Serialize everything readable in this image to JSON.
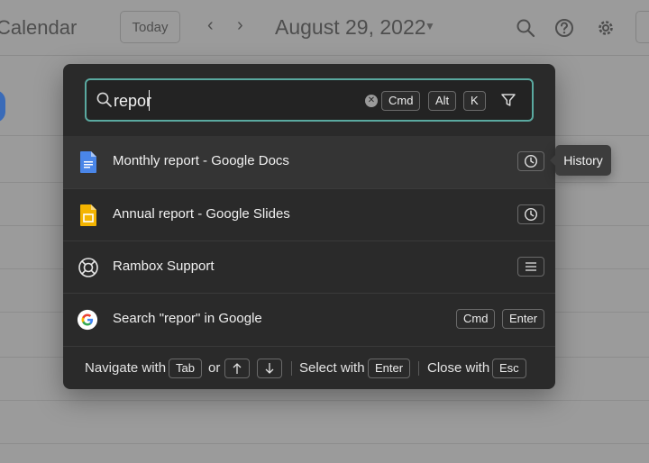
{
  "calendar": {
    "brand": "Calendar",
    "today_label": "Today",
    "prev_glyph": "‹",
    "next_glyph": "›",
    "date_label": "August 29, 2022",
    "icons": [
      "search-icon",
      "help-icon",
      "gear-icon"
    ]
  },
  "palette": {
    "search": {
      "value": "repor",
      "shortcut_keys": [
        "Cmd",
        "Alt",
        "K"
      ],
      "accent": "#5aa9a0"
    },
    "results": [
      {
        "label": "Monthly report - Google Docs",
        "icon": "google-docs-icon",
        "action_icon": "history-icon",
        "active": true
      },
      {
        "label": "Annual report - Google Slides",
        "icon": "google-slides-icon",
        "action_icon": "history-icon",
        "active": false
      },
      {
        "label": "Rambox Support",
        "icon": "lifebuoy-icon",
        "action_icon": "menu-icon",
        "active": false
      },
      {
        "label": "Search \"repor\" in Google",
        "icon": "google-icon",
        "keys": [
          "Cmd",
          "Enter"
        ],
        "active": false
      }
    ],
    "footer": {
      "navigate_label": "Navigate with",
      "navigate_key": "Tab",
      "or_label": "or",
      "select_label": "Select with",
      "select_key": "Enter",
      "close_label": "Close with",
      "close_key": "Esc"
    }
  },
  "tooltip": {
    "label": "History"
  }
}
